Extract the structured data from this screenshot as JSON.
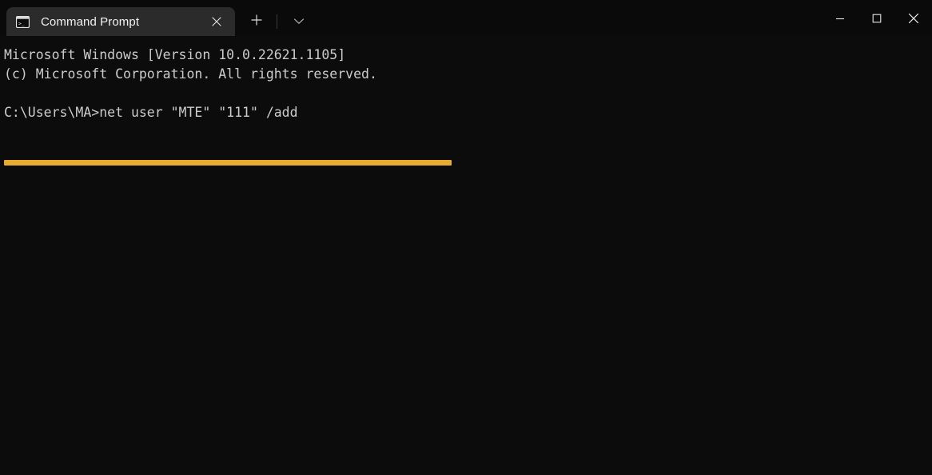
{
  "window": {
    "title": "Command Prompt",
    "background": "#0c0c0c",
    "titlebar_background": "#0a0a0a",
    "tab_background": "#2b2b2b"
  },
  "tabstrip": {
    "tabs": [
      {
        "label": "Command Prompt",
        "icon": "console-icon",
        "close_label": "×",
        "active": true
      }
    ],
    "new_tab_label": "+",
    "dropdown_label": "∨"
  },
  "window_controls": {
    "minimize_label": "—",
    "maximize_label": "□",
    "close_label": "×"
  },
  "terminal": {
    "foreground": "#cccccc",
    "highlight_color": "#e8ab31",
    "lines": [
      "Microsoft Windows [Version 10.0.22621.1105]",
      "(c) Microsoft Corporation. All rights reserved.",
      "",
      "C:\\Users\\MA>net user \"MTE\" \"111\" /add"
    ],
    "prompt": "C:\\Users\\MA>",
    "command": "net user \"MTE\" \"111\" /add",
    "version_line": "Microsoft Windows [Version 10.0.22621.1105]",
    "copyright_line": "(c) Microsoft Corporation. All rights reserved."
  }
}
